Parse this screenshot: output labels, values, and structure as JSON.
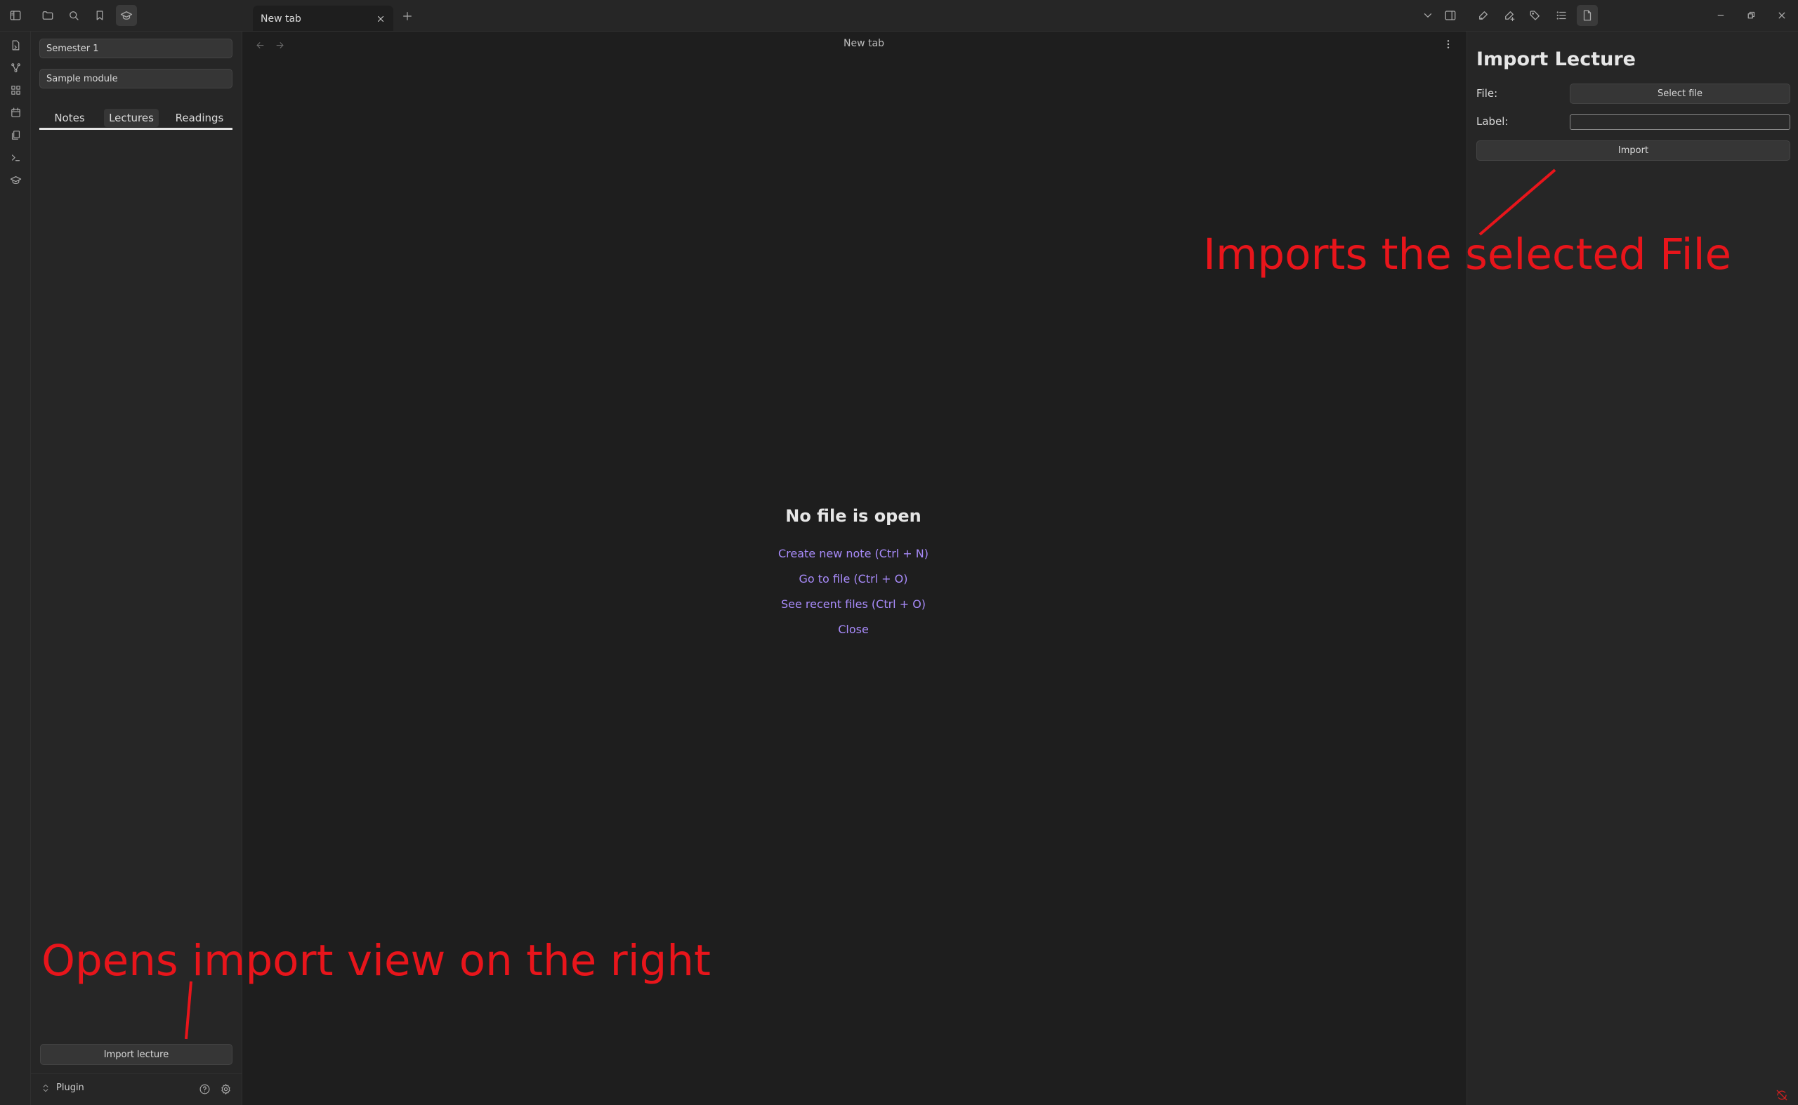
{
  "titlebar": {
    "left_icons": [
      "sidebar-toggle-icon",
      "folder-icon",
      "search-icon",
      "bookmark-icon",
      "graduation-cap-icon"
    ],
    "tab": {
      "label": "New tab"
    },
    "right_icons": [
      "chevron-down-icon",
      "right-sidebar-toggle-icon",
      "pen-link-icon",
      "pen-plus-icon",
      "tags-icon",
      "list-icon",
      "file-icon"
    ],
    "window_controls": [
      "minimize-icon",
      "restore-icon",
      "close-icon"
    ]
  },
  "ribbon": {
    "icons": [
      "open-quick-switcher-icon",
      "graph-view-icon",
      "canvas-icon",
      "daily-note-icon",
      "templates-icon",
      "command-palette-icon",
      "lecture-plugin-icon"
    ]
  },
  "sidebar": {
    "semester_select": "Semester 1",
    "module_select": "Sample module",
    "tabs": [
      {
        "label": "Notes",
        "active": false
      },
      {
        "label": "Lectures",
        "active": true
      },
      {
        "label": "Readings",
        "active": false
      }
    ],
    "import_button": "Import lecture",
    "vault_name": "Plugin"
  },
  "main": {
    "view_title": "New tab",
    "empty_title": "No file is open",
    "actions": [
      "Create new note (Ctrl + N)",
      "Go to file (Ctrl + O)",
      "See recent files (Ctrl + O)",
      "Close"
    ]
  },
  "import_panel": {
    "title": "Import Lecture",
    "file_label": "File:",
    "select_file_button": "Select file",
    "label_label": "Label:",
    "label_value": "",
    "import_button": "Import"
  },
  "annotations": {
    "right_note": "Imports the selected File",
    "left_note": "Opens import view on the right"
  },
  "colors": {
    "accent": "#a88bfa",
    "annotation": "#e8151b",
    "background": "#1e1e1e",
    "panel": "#262626"
  }
}
